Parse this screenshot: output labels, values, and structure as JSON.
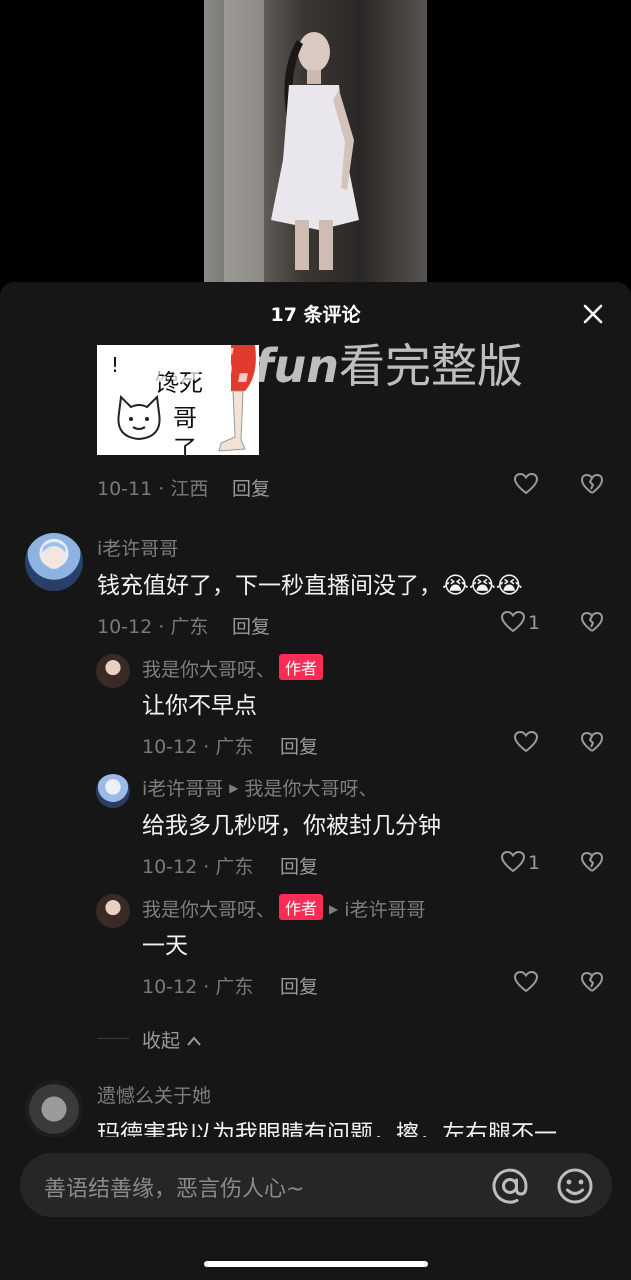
{
  "header": {
    "title": "17 条评论"
  },
  "comments": [
    {
      "sticker_text": [
        "馋死",
        "哥",
        "了",
        "!"
      ],
      "date_location": "10-11 · 江西",
      "reply_label": "回复"
    },
    {
      "username": "i老许哥哥",
      "text": "钱充值好了，下一秒直播间没了，😭😭😭",
      "date_location": "10-12 · 广东",
      "reply_label": "回复",
      "like_count": "1",
      "replies": [
        {
          "username": "我是你大哥呀、",
          "badge": "作者",
          "text": "让你不早点",
          "date_location": "10-12 · 广东",
          "reply_label": "回复"
        },
        {
          "username": "i老许哥哥",
          "reply_to": "我是你大哥呀、",
          "text": "给我多几秒呀，你被封几分钟",
          "date_location": "10-12 · 广东",
          "reply_label": "回复",
          "like_count": "1"
        },
        {
          "username": "我是你大哥呀、",
          "badge": "作者",
          "reply_to": "i老许哥哥",
          "text": "一天",
          "date_location": "10-12 · 广东",
          "reply_label": "回复"
        }
      ],
      "collapse_label": "收起"
    },
    {
      "username": "遗憾么关于她",
      "text": "玛德害我以为我眼睛有问题，擦，左右腿不一"
    }
  ],
  "watermark": {
    "url": "155.fun",
    "text": "看完整版"
  },
  "input": {
    "placeholder": "善语结善缘，恶言伤人心~"
  },
  "colors": {
    "accent": "#fe2c55",
    "background": "#161616",
    "text_muted": "#7d7d7d"
  }
}
